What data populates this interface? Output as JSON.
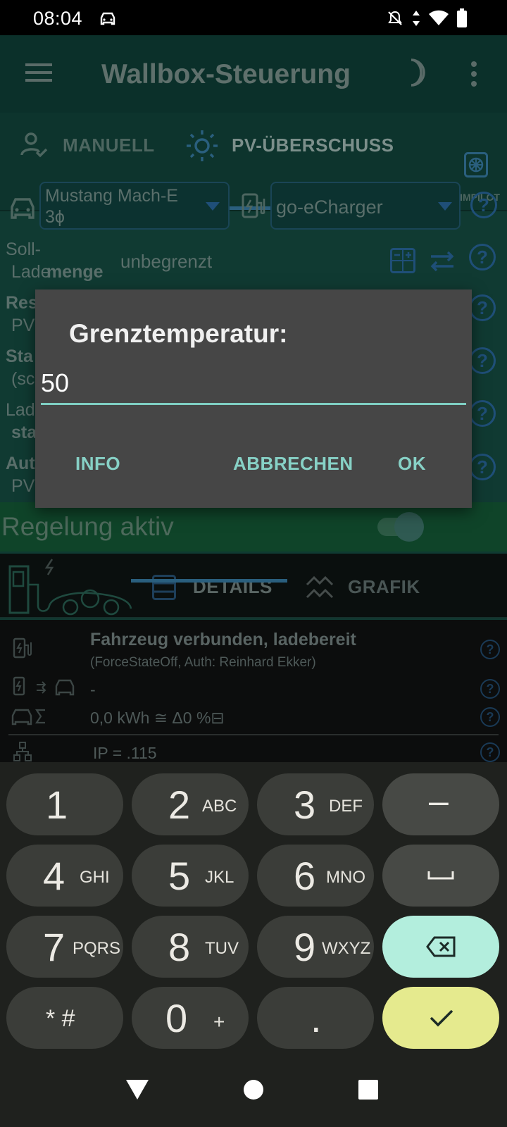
{
  "status_bar": {
    "time": "08:04"
  },
  "toolbar": {
    "title": "Wallbox-Steuerung"
  },
  "tabs": [
    {
      "label": "MANUELL"
    },
    {
      "label": "PV-ÜBERSCHUSS"
    },
    {
      "label": "OHMPILOT"
    }
  ],
  "vehicle_select": {
    "line1": "Mustang Mach-E",
    "line2": "3ϕ"
  },
  "charger_select": {
    "value": "go-eCharger"
  },
  "soll_ladung": {
    "label1": "Soll-",
    "label2_a": "Lade",
    "label2_b": "menge",
    "value": "unbegrenzt"
  },
  "partial_rows": [
    {
      "a": "Res",
      "b": "PV"
    },
    {
      "a": "Sta",
      "b": "(sc"
    },
    {
      "a": "Lad",
      "b": "sta"
    },
    {
      "a": "Aut",
      "b": "PV"
    }
  ],
  "regelung": {
    "label": "Regelung aktiv",
    "on": true
  },
  "subtabs": [
    {
      "label": "DETAILS"
    },
    {
      "label": "GRAFIK"
    }
  ],
  "details": {
    "status_title": "Fahrzeug verbunden, ladebereit",
    "status_sub": "(ForceStateOff, Auth: Reinhard Ekker)",
    "flow_value": "-",
    "energy_value": "0,0 kWh ≅ Δ0 %⊟",
    "ip_value": "IP = .115"
  },
  "dialog": {
    "title": "Grenztemperatur:",
    "value": "50",
    "info": "INFO",
    "cancel": "ABBRECHEN",
    "ok": "OK"
  },
  "keyboard": {
    "keys": [
      {
        "num": "1",
        "sub": ""
      },
      {
        "num": "2",
        "sub": "ABC"
      },
      {
        "num": "3",
        "sub": "DEF"
      },
      {
        "num": "4",
        "sub": "GHI"
      },
      {
        "num": "5",
        "sub": "JKL"
      },
      {
        "num": "6",
        "sub": "MNO"
      },
      {
        "num": "7",
        "sub": "PQRS"
      },
      {
        "num": "8",
        "sub": "TUV"
      },
      {
        "num": "9",
        "sub": "WXYZ"
      },
      {
        "num": "* #",
        "sub": ""
      },
      {
        "num": "0",
        "sub": "+"
      },
      {
        "num": ".",
        "sub": ""
      }
    ],
    "minus": "–"
  },
  "colors": {
    "accent": "#87d1c6",
    "dialog_bg": "#464646",
    "key_delete": "#b3eedd",
    "key_done": "#e5ea8e"
  }
}
